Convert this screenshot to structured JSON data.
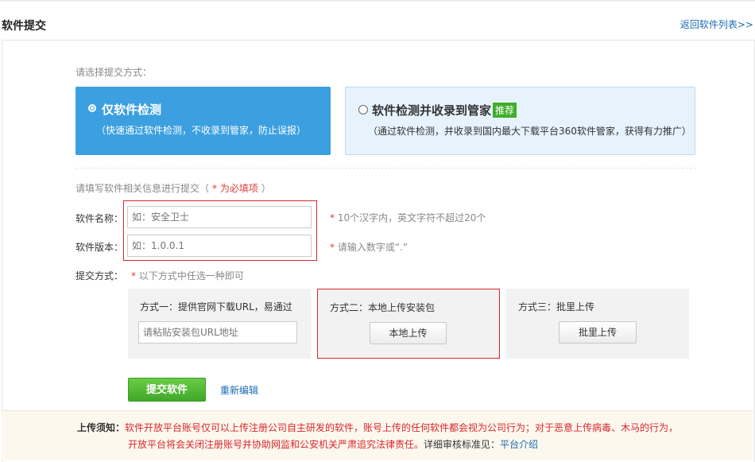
{
  "header": {
    "title": "软件提交",
    "back_link": "返回软件列表>>"
  },
  "choose_label": "请选择提交方式：",
  "options": [
    {
      "title": "仅软件检测",
      "desc": "（快速通过软件检测，不收录到管家，防止误报）",
      "selected": true
    },
    {
      "title": "软件检测并收录到管家",
      "badge": "推荐",
      "desc": "（通过软件检测，并收录到国内最大下载平台360软件管家，获得有力推广）",
      "selected": false
    }
  ],
  "info_prompt": {
    "prefix": "请填写软件相关信息进行提交（",
    "required": "* 为必填项",
    "suffix": "）"
  },
  "fields": {
    "name": {
      "label": "软件名称：",
      "placeholder": "如：安全卫士",
      "hint_star": "*",
      "hint": "10个汉字内，英文字符不超过20个"
    },
    "version": {
      "label": "软件版本：",
      "placeholder": "如：1.0.0.1",
      "hint_star": "*",
      "hint": "请输入数字或“.”"
    }
  },
  "submit_method": {
    "label": "提交方式：",
    "hint_star": "*",
    "hint": "以下方式中任选一种即可"
  },
  "methods": [
    {
      "title": "方式一：提供官网下载URL，易通过",
      "placeholder": "请粘贴安装包URL地址"
    },
    {
      "title": "方式二：本地上传安装包",
      "button": "本地上传"
    },
    {
      "title": "方式三：批里上传",
      "button": "批里上传"
    }
  ],
  "actions": {
    "submit": "提交软件",
    "reedit": "重新编辑"
  },
  "notice": {
    "label": "上传须知：",
    "line1": "软件开放平台账号仅可以上传注册公司自主研发的软件，账号上传的任何软件都会视为公司行为；对于恶意上传病毒、木马的行为，",
    "line2": "开放平台将会关闭注册账号并协助网监和公安机关严肃追究法律责任。",
    "detail": "详细审核标准见：",
    "link": "平台介绍"
  },
  "colors": {
    "accent": "#3ca0e0",
    "link": "#1a6bb5",
    "required": "#e03c3c",
    "submit": "#40a82a"
  }
}
